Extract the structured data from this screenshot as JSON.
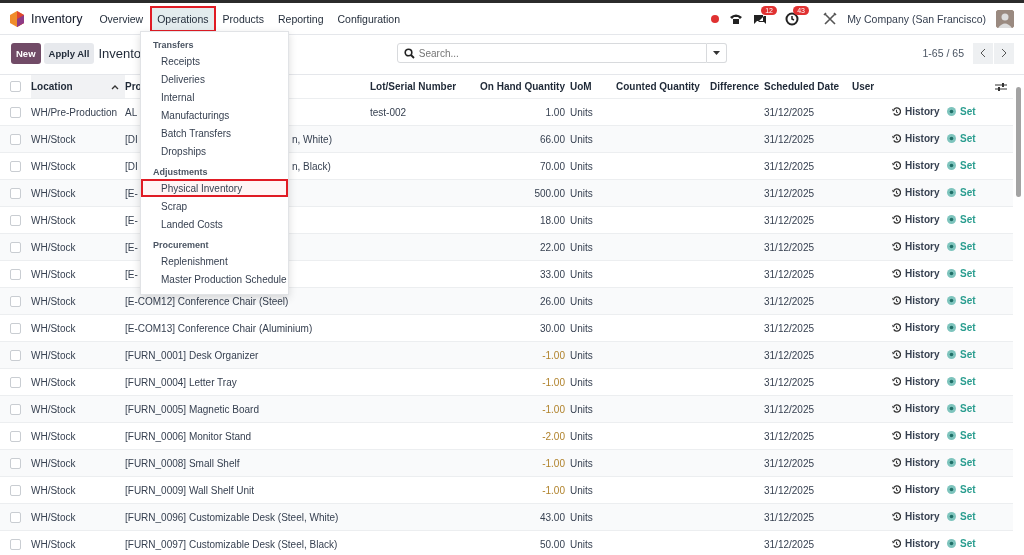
{
  "app": {
    "name": "Inventory"
  },
  "nav": [
    {
      "label": "Overview",
      "selected": false
    },
    {
      "label": "Operations",
      "selected": true
    },
    {
      "label": "Products",
      "selected": false
    },
    {
      "label": "Reporting",
      "selected": false
    },
    {
      "label": "Configuration",
      "selected": false
    }
  ],
  "systray": {
    "chat_count": "12",
    "activity_count": "43",
    "company": "My Company (San Francisco)"
  },
  "control_panel": {
    "buttons": [
      {
        "label": "New",
        "kind": "primary"
      },
      {
        "label": "Apply All",
        "kind": "secondary"
      }
    ],
    "breadcrumb": "Invento",
    "search": {
      "placeholder": "Search..."
    },
    "pager": "1-65 / 65"
  },
  "table": {
    "select_all_checked": false,
    "columns": [
      {
        "label": "Location",
        "sorted": true
      },
      {
        "label": "Pro",
        "sorted": false
      },
      {
        "label": "Lot/Serial Number",
        "sorted": false
      },
      {
        "label": "On Hand Quantity",
        "sorted": false
      },
      {
        "label": "UoM",
        "sorted": false
      },
      {
        "label": "Counted Quantity",
        "sorted": false
      },
      {
        "label": "Difference",
        "sorted": false
      },
      {
        "label": "Scheduled Date",
        "sorted": false
      },
      {
        "label": "User",
        "sorted": false
      }
    ],
    "rows": [
      {
        "checked": false,
        "location": "WH/Pre-Production",
        "product": "AL",
        "lot": "test-002",
        "on_hand": "1.00",
        "negative": false,
        "uom": "Units",
        "date": "31/12/2025",
        "history": "History",
        "set": "Set"
      },
      {
        "checked": false,
        "location": "WH/Stock",
        "product": "[DI",
        "product_tail": "n, White)",
        "on_hand": "66.00",
        "negative": false,
        "uom": "Units",
        "date": "31/12/2025",
        "history": "History",
        "set": "Set"
      },
      {
        "checked": false,
        "location": "WH/Stock",
        "product": "[DI",
        "product_tail": "n, Black)",
        "on_hand": "70.00",
        "negative": false,
        "uom": "Units",
        "date": "31/12/2025",
        "history": "History",
        "set": "Set"
      },
      {
        "checked": false,
        "location": "WH/Stock",
        "product": "[E-",
        "on_hand": "500.00",
        "negative": false,
        "uom": "Units",
        "date": "31/12/2025",
        "history": "History",
        "set": "Set"
      },
      {
        "checked": false,
        "location": "WH/Stock",
        "product": "[E-",
        "on_hand": "18.00",
        "negative": false,
        "uom": "Units",
        "date": "31/12/2025",
        "history": "History",
        "set": "Set"
      },
      {
        "checked": false,
        "location": "WH/Stock",
        "product": "[E-",
        "on_hand": "22.00",
        "negative": false,
        "uom": "Units",
        "date": "31/12/2025",
        "history": "History",
        "set": "Set"
      },
      {
        "checked": false,
        "location": "WH/Stock",
        "product": "[E-",
        "on_hand": "33.00",
        "negative": false,
        "uom": "Units",
        "date": "31/12/2025",
        "history": "History",
        "set": "Set"
      },
      {
        "checked": false,
        "location": "WH/Stock",
        "product": "[E-COM12] Conference Chair (Steel)",
        "on_hand": "26.00",
        "negative": false,
        "uom": "Units",
        "date": "31/12/2025",
        "history": "History",
        "set": "Set"
      },
      {
        "checked": false,
        "location": "WH/Stock",
        "product": "[E-COM13] Conference Chair (Aluminium)",
        "on_hand": "30.00",
        "negative": false,
        "uom": "Units",
        "date": "31/12/2025",
        "history": "History",
        "set": "Set"
      },
      {
        "checked": false,
        "location": "WH/Stock",
        "product": "[FURN_0001] Desk Organizer",
        "on_hand": "-1.00",
        "negative": true,
        "uom": "Units",
        "date": "31/12/2025",
        "history": "History",
        "set": "Set"
      },
      {
        "checked": false,
        "location": "WH/Stock",
        "product": "[FURN_0004] Letter Tray",
        "on_hand": "-1.00",
        "negative": true,
        "uom": "Units",
        "date": "31/12/2025",
        "history": "History",
        "set": "Set"
      },
      {
        "checked": false,
        "location": "WH/Stock",
        "product": "[FURN_0005] Magnetic Board",
        "on_hand": "-1.00",
        "negative": true,
        "uom": "Units",
        "date": "31/12/2025",
        "history": "History",
        "set": "Set"
      },
      {
        "checked": false,
        "location": "WH/Stock",
        "product": "[FURN_0006] Monitor Stand",
        "on_hand": "-2.00",
        "negative": true,
        "uom": "Units",
        "date": "31/12/2025",
        "history": "History",
        "set": "Set"
      },
      {
        "checked": false,
        "location": "WH/Stock",
        "product": "[FURN_0008] Small Shelf",
        "on_hand": "-1.00",
        "negative": true,
        "uom": "Units",
        "date": "31/12/2025",
        "history": "History",
        "set": "Set"
      },
      {
        "checked": false,
        "location": "WH/Stock",
        "product": "[FURN_0009] Wall Shelf Unit",
        "on_hand": "-1.00",
        "negative": true,
        "uom": "Units",
        "date": "31/12/2025",
        "history": "History",
        "set": "Set"
      },
      {
        "checked": false,
        "location": "WH/Stock",
        "product": "[FURN_0096] Customizable Desk (Steel, White)",
        "on_hand": "43.00",
        "negative": false,
        "uom": "Units",
        "date": "31/12/2025",
        "history": "History",
        "set": "Set"
      },
      {
        "checked": false,
        "location": "WH/Stock",
        "product": "[FURN_0097] Customizable Desk (Steel, Black)",
        "on_hand": "50.00",
        "negative": false,
        "uom": "Units",
        "date": "31/12/2025",
        "history": "History",
        "set": "Set"
      }
    ]
  },
  "menu": {
    "sections": [
      {
        "title": "Transfers",
        "items": [
          {
            "label": "Receipts",
            "highlighted": false
          },
          {
            "label": "Deliveries",
            "highlighted": false
          },
          {
            "label": "Internal",
            "highlighted": false
          },
          {
            "label": "Manufacturings",
            "highlighted": false
          },
          {
            "label": "Batch Transfers",
            "highlighted": false
          },
          {
            "label": "Dropships",
            "highlighted": false
          }
        ]
      },
      {
        "title": "Adjustments",
        "items": [
          {
            "label": "Physical Inventory",
            "highlighted": true
          },
          {
            "label": "Scrap",
            "highlighted": false
          },
          {
            "label": "Landed Costs",
            "highlighted": false
          }
        ]
      },
      {
        "title": "Procurement",
        "items": [
          {
            "label": "Replenishment",
            "highlighted": false
          },
          {
            "label": "Master Production Schedule",
            "highlighted": false
          }
        ]
      }
    ]
  }
}
